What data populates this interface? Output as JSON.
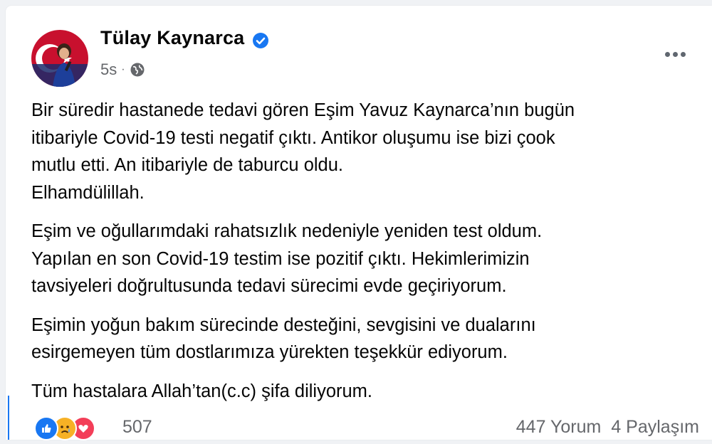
{
  "post": {
    "author": "Tülay Kaynarca",
    "timestamp": "5s",
    "audience_icon": "globe-icon",
    "verified_icon": "verified-badge-icon",
    "more_icon": "more-options-icon",
    "paragraphs": [
      "Bir süredir hastanede tedavi gören Eşim Yavuz Kaynarca’nın bugün\nitibariyle Covid-19 testi negatif çıktı. Antikor oluşumu ise bizi çook\nmutlu etti. An itibariyle de taburcu oldu.\nElhamdülillah.",
      "Eşim ve oğullarımdaki rahatsızlık nedeniyle yeniden test oldum.\nYapılan en son Covid-19 testim ise pozitif çıktı. Hekimlerimizin\ntavsiyeleri doğrultusunda tedavi sürecimi evde geçiriyorum.",
      "Eşimin yoğun bakım sürecinde desteğini, sevgisini ve dualarını\nesirgemeyen tüm dostlarımıza yürekten teşekkür ediyorum.",
      "Tüm hastalara Allah’tan(c.c) şifa diliyorum."
    ]
  },
  "footer": {
    "reactions": [
      "like-icon",
      "sad-icon",
      "love-icon"
    ],
    "reaction_count": "507",
    "comments": "447 Yorum",
    "shares": "4 Paylaşım"
  },
  "colors": {
    "accent": "#1877f2",
    "text": "#050505",
    "secondary_text": "#65676b",
    "love": "#f33e58",
    "sad": "#f7b125"
  }
}
